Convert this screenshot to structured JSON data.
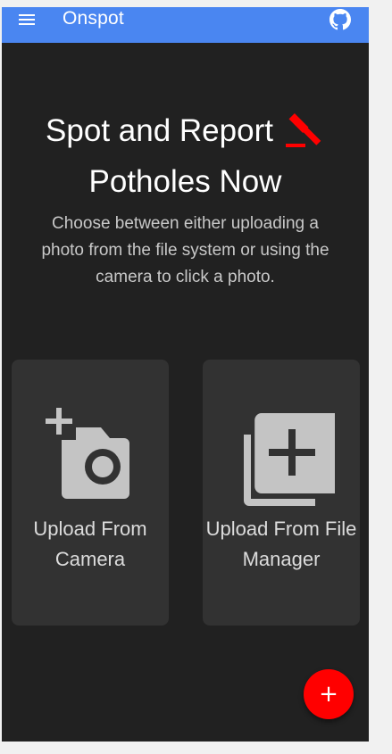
{
  "appbar": {
    "title": "Onspot",
    "menu_icon": "menu-icon",
    "github_icon": "github-icon",
    "color": "#4a86f1"
  },
  "hero": {
    "title_line1": "Spot and Report",
    "title_line2": "Potholes Now",
    "logo_icon": "gavel-icon",
    "logo_color": "#ff0000",
    "description": "Choose between either uploading a photo from the file system or using the camera to click a photo."
  },
  "cards": [
    {
      "label": "Upload From Camera",
      "icon": "add-a-photo-icon"
    },
    {
      "label": "Upload From File Manager",
      "icon": "add-to-photos-icon"
    }
  ],
  "fab": {
    "label": "+",
    "color": "#ff0000"
  }
}
